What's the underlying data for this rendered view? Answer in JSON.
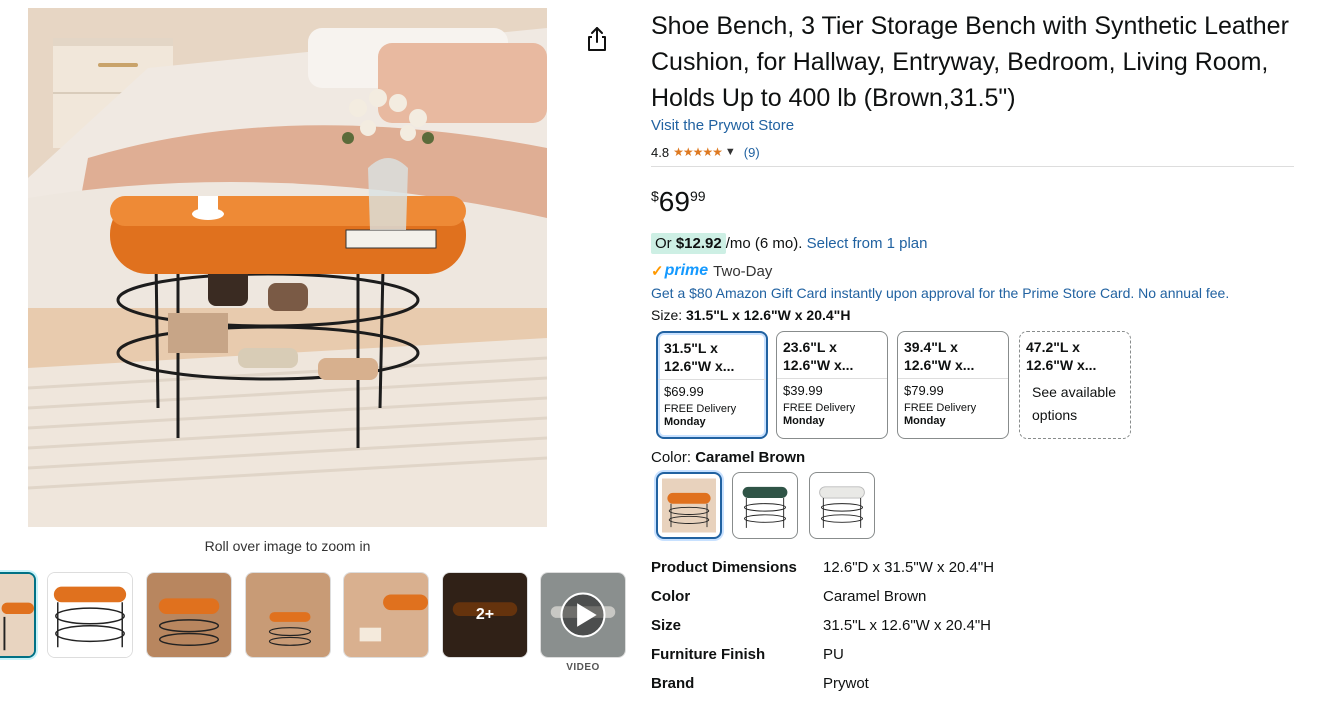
{
  "gallery": {
    "zoom_hint": "Roll over image to zoom in",
    "more_count_label": "2+",
    "video_label": "VIDEO"
  },
  "product": {
    "title": "Shoe Bench, 3 Tier Storage Bench with Synthetic Leather Cushion, for Hallway, Entryway, Bedroom, Living Room, Holds Up to 400 lb (Brown,31.5\")",
    "store_link": "Visit the Prywot Store",
    "rating": "4.8",
    "rating_count": "(9)",
    "stars": "★★★★★"
  },
  "price": {
    "symbol": "$",
    "whole": "69",
    "fraction": "99",
    "monthly_prefix": "Or ",
    "monthly_amount": "$12.92",
    "monthly_suffix": "/mo (6 mo). ",
    "plan_link": "Select from 1 plan"
  },
  "prime": {
    "check": "✓",
    "word": "prime",
    "delivery": "Two-Day"
  },
  "gift_offer": "Get a $80 Amazon Gift Card instantly upon approval for the Prime Store Card. No annual fee.",
  "size": {
    "label": "Size: ",
    "selected": "31.5\"L x 12.6\"W x 20.4\"H",
    "options": [
      {
        "name": "31.5\"L x\n12.6\"W x...",
        "price": "$69.99",
        "delivery": "FREE Delivery",
        "day": "Monday"
      },
      {
        "name": "23.6\"L x\n12.6\"W x...",
        "price": "$39.99",
        "delivery": "FREE Delivery",
        "day": "Monday"
      },
      {
        "name": "39.4\"L x\n12.6\"W x...",
        "price": "$79.99",
        "delivery": "FREE Delivery",
        "day": "Monday"
      },
      {
        "name": "47.2\"L x\n12.6\"W x...",
        "availability": "See available options"
      }
    ]
  },
  "color": {
    "label": "Color: ",
    "selected": "Caramel Brown"
  },
  "specs": [
    {
      "key": "Product Dimensions",
      "value": "12.6\"D x 31.5\"W x 20.4\"H"
    },
    {
      "key": "Color",
      "value": "Caramel Brown"
    },
    {
      "key": "Size",
      "value": "31.5\"L x 12.6\"W x 20.4\"H"
    },
    {
      "key": "Furniture Finish",
      "value": "PU"
    },
    {
      "key": "Brand",
      "value": "Prywot"
    }
  ],
  "colors": {
    "link": "#2162a1",
    "price_pill": "#cdefe4",
    "prime_blue": "#1399ff",
    "star_orange": "#de7921",
    "selected_border": "#2162a1"
  }
}
